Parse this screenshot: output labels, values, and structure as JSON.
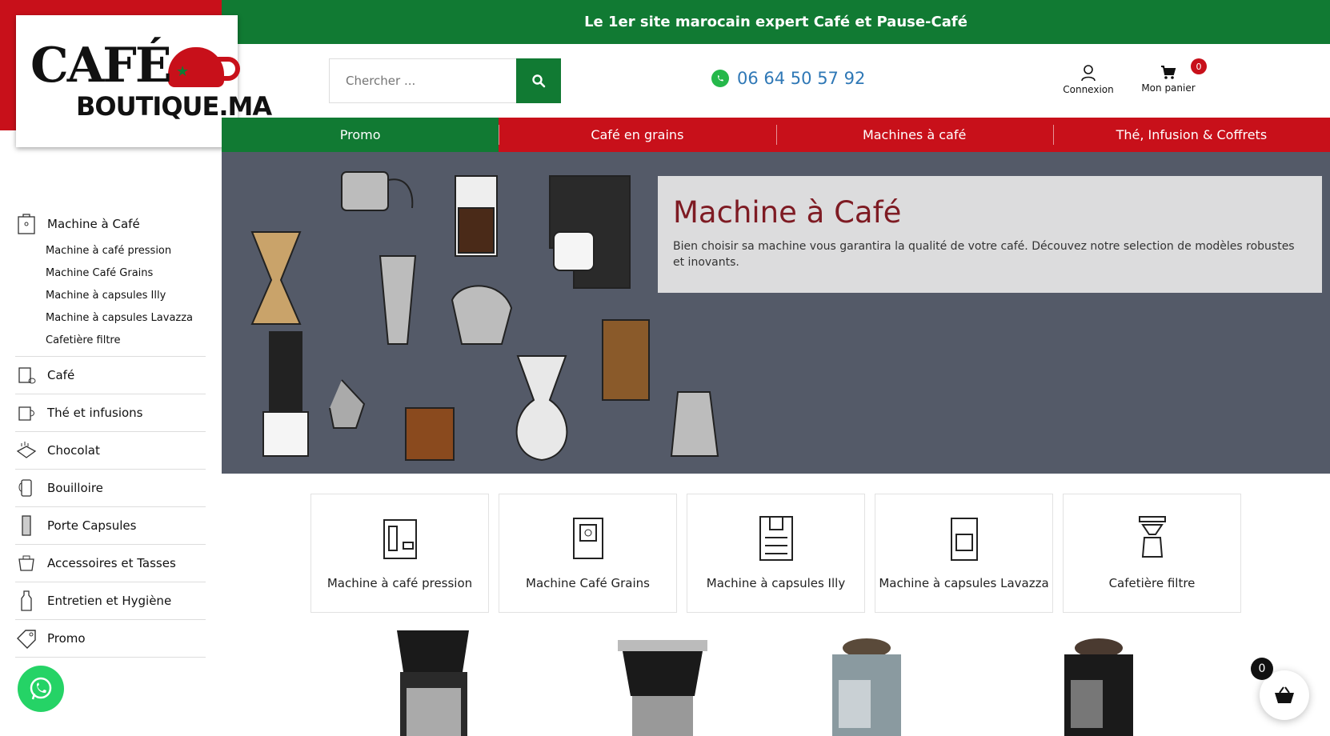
{
  "topbar": {
    "tagline": "Le 1er site marocain expert Café et Pause-Café"
  },
  "logo": {
    "line1": "CAFÉ",
    "line2": "BOUTIQUE.MA"
  },
  "search": {
    "placeholder": "Chercher ..."
  },
  "phone": "06 64 50 57 92",
  "account": {
    "login_label": "Connexion",
    "cart_label": "Mon panier",
    "cart_count": "0"
  },
  "nav": [
    {
      "label": "Promo",
      "color": "#117a33"
    },
    {
      "label": "Café en grains",
      "color": "#c8101a"
    },
    {
      "label": "Machines à café",
      "color": "#c8101a"
    },
    {
      "label": "Thé, Infusion & Coffrets",
      "color": "#c8101a"
    }
  ],
  "sidebar": {
    "machine": {
      "label": "Machine à Café",
      "icon": "coffee-machine-icon",
      "sub": [
        "Machine à café pression",
        "Machine Café Grains",
        "Machine à capsules Illy",
        "Machine à capsules Lavazza",
        "Cafetière filtre"
      ]
    },
    "items": [
      {
        "label": "Café",
        "icon": "coffee-bag-icon"
      },
      {
        "label": "Thé et infusions",
        "icon": "tea-cup-icon"
      },
      {
        "label": "Chocolat",
        "icon": "chocolate-icon"
      },
      {
        "label": "Bouilloire",
        "icon": "kettle-icon"
      },
      {
        "label": "Porte Capsules",
        "icon": "capsule-holder-icon"
      },
      {
        "label": "Accessoires et Tasses",
        "icon": "accessories-icon"
      },
      {
        "label": "Entretien et Hygiène",
        "icon": "cleaning-bottle-icon"
      },
      {
        "label": "Promo",
        "icon": "promo-tag-icon"
      }
    ]
  },
  "hero": {
    "title": "Machine à Café",
    "description": "Bien choisir sa machine vous garantira la qualité de votre café. Découvez notre selection de modèles robustes et inovants."
  },
  "categories": [
    {
      "label": "Machine à café pression",
      "icon": "espresso-machine-icon"
    },
    {
      "label": "Machine Café Grains",
      "icon": "bean-machine-icon"
    },
    {
      "label": "Machine à capsules Illy",
      "icon": "capsule-machine-icon"
    },
    {
      "label": "Machine à capsules Lavazza",
      "icon": "lavazza-machine-icon"
    },
    {
      "label": "Cafetière filtre",
      "icon": "filter-coffee-icon"
    }
  ],
  "cart_float": {
    "count": "0"
  },
  "colors": {
    "green": "#117a33",
    "red": "#c8101a",
    "hero_title": "#7e1b23",
    "phone": "#2f78b6"
  }
}
